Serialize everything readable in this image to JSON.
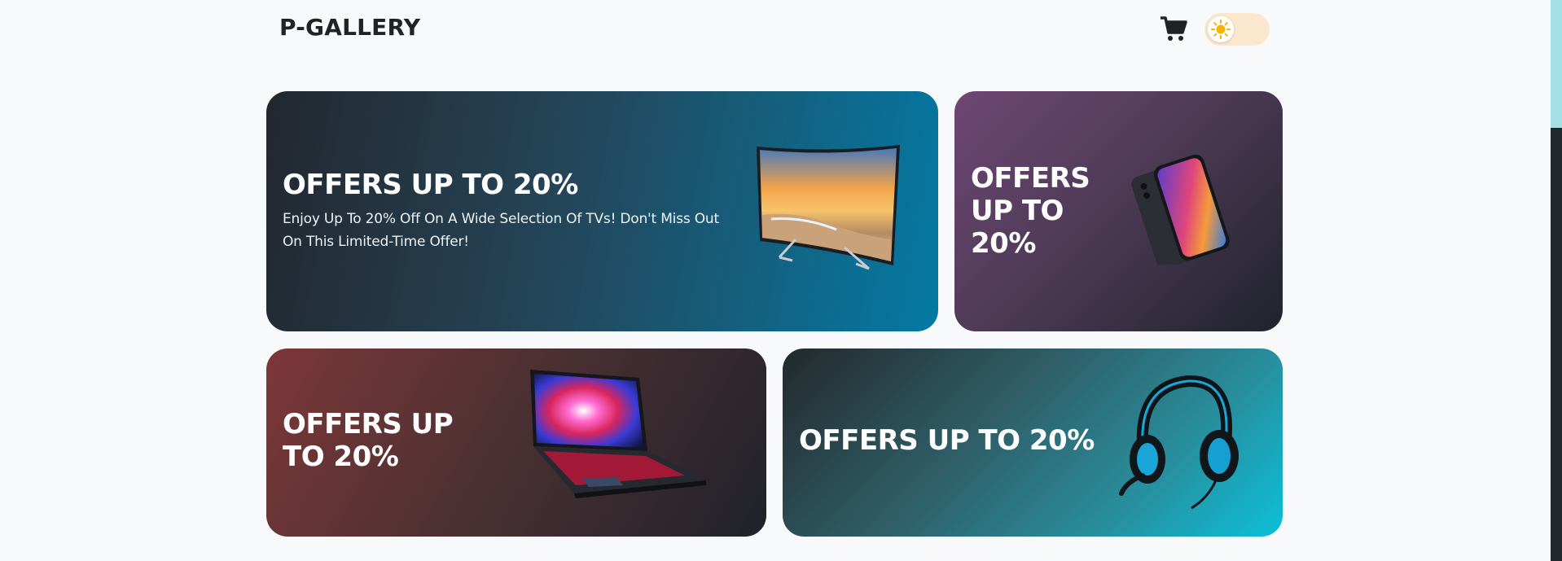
{
  "header": {
    "logo": "P-GALLERY",
    "cart_icon": "shopping-cart-icon",
    "theme_toggle_icon": "sun-icon"
  },
  "banners": [
    {
      "title": "OFFERS UP TO 20%",
      "description": "Enjoy Up To 20% Off On A Wide Selection Of TVs! Don't Miss Out On This Limited-Time Offer!",
      "image": "curved-tv"
    },
    {
      "title_lines": [
        "OFFERS",
        "UP TO",
        "20%"
      ],
      "image": "smartphone"
    },
    {
      "title_lines": [
        "OFFERS UP",
        "TO 20%"
      ],
      "image": "laptop"
    },
    {
      "title": "OFFERS UP TO 20%",
      "image": "gaming-headset"
    }
  ],
  "colors": {
    "background": "#f8f9fb",
    "toggle": "#fbe7cd",
    "sun": "#f4b400",
    "card_tv_end": "#047aa4",
    "card_phone_start": "#6f4774",
    "card_laptop_start": "#7d3738",
    "card_headset_end": "#0dbfd9"
  }
}
